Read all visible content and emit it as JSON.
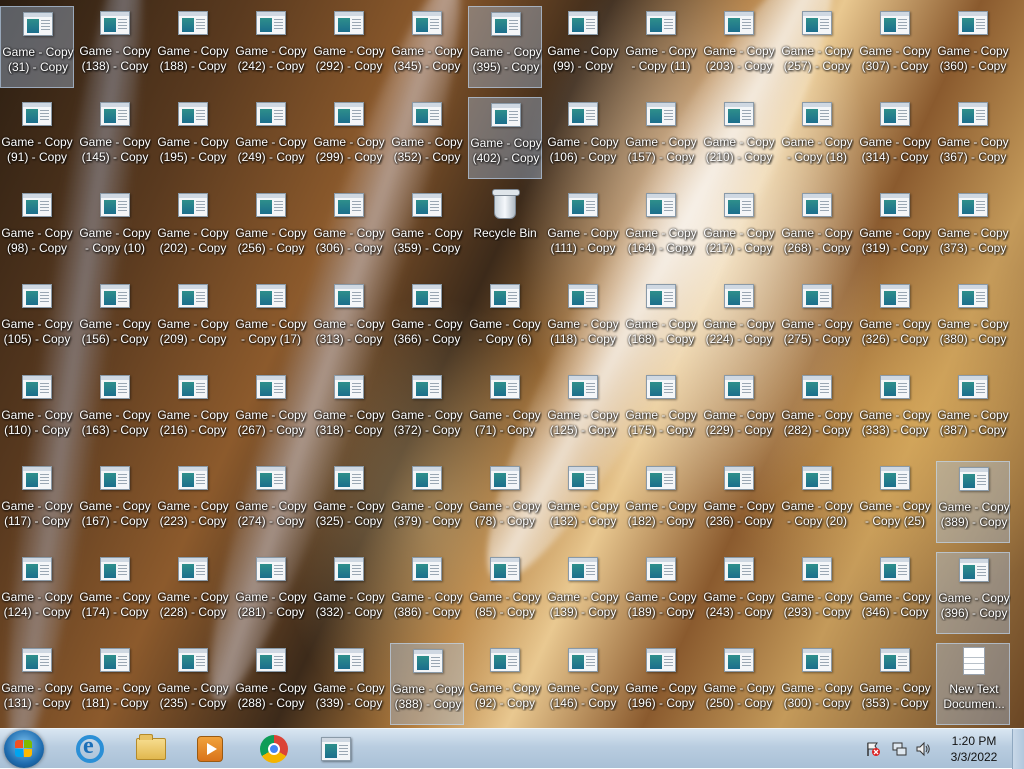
{
  "desktop": {
    "selected": [
      0,
      6,
      13
    ],
    "icons": [
      [
        "Game - Copy (31) - Copy",
        "Game - Copy (138) - Copy",
        "Game - Copy (188) - Copy",
        "Game - Copy (242) - Copy",
        "Game - Copy (292) - Copy",
        "Game - Copy (345) - Copy",
        "Game - Copy (395) - Copy",
        "Game - Copy (99) - Copy",
        "Game - Copy - Copy (11)",
        "Game - Copy (203) - Copy",
        "Game - Copy (257) - Copy",
        "Game - Copy (307) - Copy",
        "Game - Copy (360) - Copy"
      ],
      [
        "Game - Copy (91) - Copy",
        "Game - Copy (145) - Copy",
        "Game - Copy (195) - Copy",
        "Game - Copy (249) - Copy",
        "Game - Copy (299) - Copy",
        "Game - Copy (352) - Copy",
        "Game - Copy (402) - Copy",
        "Game - Copy (106) - Copy",
        "Game - Copy (157) - Copy",
        "Game - Copy (210) - Copy",
        "Game - Copy - Copy (18)",
        "Game - Copy (314) - Copy",
        "Game - Copy (367) - Copy"
      ],
      [
        "Game - Copy (98) - Copy",
        "Game - Copy - Copy (10)",
        "Game - Copy (202) - Copy",
        "Game - Copy (256) - Copy",
        "Game - Copy (306) - Copy",
        "Game - Copy (359) - Copy",
        "Recycle Bin",
        "Game - Copy (111) - Copy",
        "Game - Copy (164) - Copy",
        "Game - Copy (217) - Copy",
        "Game - Copy (268) - Copy",
        "Game - Copy (319) - Copy",
        "Game - Copy (373) - Copy"
      ],
      [
        "Game - Copy (105) - Copy",
        "Game - Copy (156) - Copy",
        "Game - Copy (209) - Copy",
        "Game - Copy - Copy (17)",
        "Game - Copy (313) - Copy",
        "Game - Copy (366) - Copy",
        "Game - Copy - Copy (6)",
        "Game - Copy (118) - Copy",
        "Game - Copy (168) - Copy",
        "Game - Copy (224) - Copy",
        "Game - Copy (275) - Copy",
        "Game - Copy (326) - Copy",
        "Game - Copy (380) - Copy"
      ],
      [
        "Game - Copy (110) - Copy",
        "Game - Copy (163) - Copy",
        "Game - Copy (216) - Copy",
        "Game - Copy (267) - Copy",
        "Game - Copy (318) - Copy",
        "Game - Copy (372) - Copy",
        "Game - Copy (71) - Copy",
        "Game - Copy (125) - Copy",
        "Game - Copy (175) - Copy",
        "Game - Copy (229) - Copy",
        "Game - Copy (282) - Copy",
        "Game - Copy (333) - Copy",
        "Game - Copy (387) - Copy"
      ],
      [
        "Game - Copy (117) - Copy",
        "Game - Copy (167) - Copy",
        "Game - Copy (223) - Copy",
        "Game - Copy (274) - Copy",
        "Game - Copy (325) - Copy",
        "Game - Copy (379) - Copy",
        "Game - Copy (78) - Copy",
        "Game - Copy (132) - Copy",
        "Game - Copy (182) - Copy",
        "Game - Copy (236) - Copy",
        "Game - Copy - Copy (20)",
        "Game - Copy - Copy (25)",
        "Game - Copy (389) - Copy"
      ],
      [
        "Game - Copy (124) - Copy",
        "Game - Copy (174) - Copy",
        "Game - Copy (228) - Copy",
        "Game - Copy (281) - Copy",
        "Game - Copy (332) - Copy",
        "Game - Copy (386) - Copy",
        "Game - Copy (85) - Copy",
        "Game - Copy (139) - Copy",
        "Game - Copy (189) - Copy",
        "Game - Copy (243) - Copy",
        "Game - Copy (293) - Copy",
        "Game - Copy (346) - Copy",
        "Game - Copy (396) - Copy"
      ],
      [
        "Game - Copy (131) - Copy",
        "Game - Copy (181) - Copy",
        "Game - Copy (235) - Copy",
        "Game - Copy (288) - Copy",
        "Game - Copy (339) - Copy",
        "Game - Copy (388) - Copy",
        "Game - Copy (92) - Copy",
        "Game - Copy (146) - Copy",
        "Game - Copy (196) - Copy",
        "Game - Copy (250) - Copy",
        "Game - Copy (300) - Copy",
        "Game - Copy (353) - Copy",
        "New Text Documen..."
      ]
    ],
    "selected_cells": [
      "0-0",
      "0-6",
      "1-6",
      "5-12",
      "6-12",
      "7-5",
      "7-12"
    ]
  },
  "taskbar": {
    "items": [
      {
        "name": "internet-explorer-icon"
      },
      {
        "name": "windows-explorer-icon"
      },
      {
        "name": "media-player-icon"
      },
      {
        "name": "chrome-icon"
      },
      {
        "name": "game-app-icon"
      }
    ],
    "clock": {
      "time": "1:20 PM",
      "date": "3/3/2022"
    },
    "colors": {
      "taskbar_top": "#d9e6f2",
      "taskbar_bottom": "#a9c0d6"
    }
  }
}
